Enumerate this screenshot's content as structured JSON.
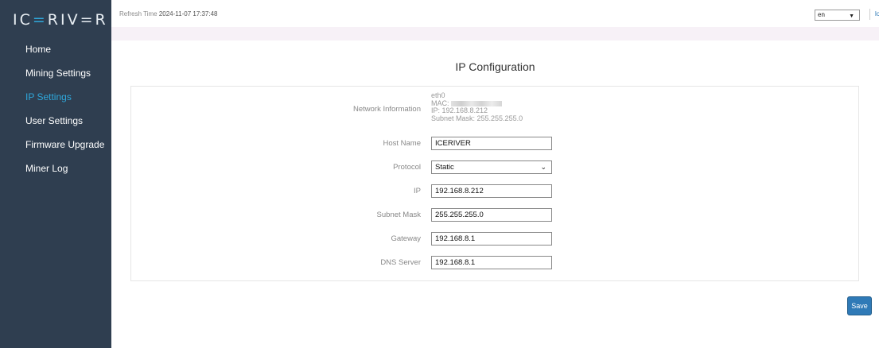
{
  "brand": {
    "logo_prefix": "IC",
    "logo_accent": "=",
    "logo_suffix": "RIV=R"
  },
  "sidebar": {
    "items": [
      {
        "label": "Home"
      },
      {
        "label": "Mining Settings"
      },
      {
        "label": "IP Settings"
      },
      {
        "label": "User Settings"
      },
      {
        "label": "Firmware Upgrade"
      },
      {
        "label": "Miner Log"
      }
    ],
    "active_index": 2
  },
  "header": {
    "refresh_label": "Refresh Time",
    "refresh_time": "2024-11-07 17:37:48",
    "language": "en",
    "logout_label": "logou"
  },
  "page": {
    "title": "IP Configuration"
  },
  "form": {
    "network_info_label": "Network Information",
    "interface": "eth0",
    "mac_label": "MAC:",
    "ip_line": "IP: 192.168.8.212",
    "mask_line": "Subnet Mask: 255.255.255.0",
    "host_name_label": "Host Name",
    "host_name": "ICERIVER",
    "protocol_label": "Protocol",
    "protocol": "Static",
    "ip_label": "IP",
    "ip": "192.168.8.212",
    "subnet_mask_label": "Subnet Mask",
    "subnet_mask": "255.255.255.0",
    "gateway_label": "Gateway",
    "gateway": "192.168.8.1",
    "dns_label": "DNS Server",
    "dns": "192.168.8.1"
  },
  "actions": {
    "save_label": "Save"
  },
  "colors": {
    "sidebar_bg": "#2f3e50",
    "accent": "#2fa8dc",
    "button": "#2f7ab7"
  }
}
